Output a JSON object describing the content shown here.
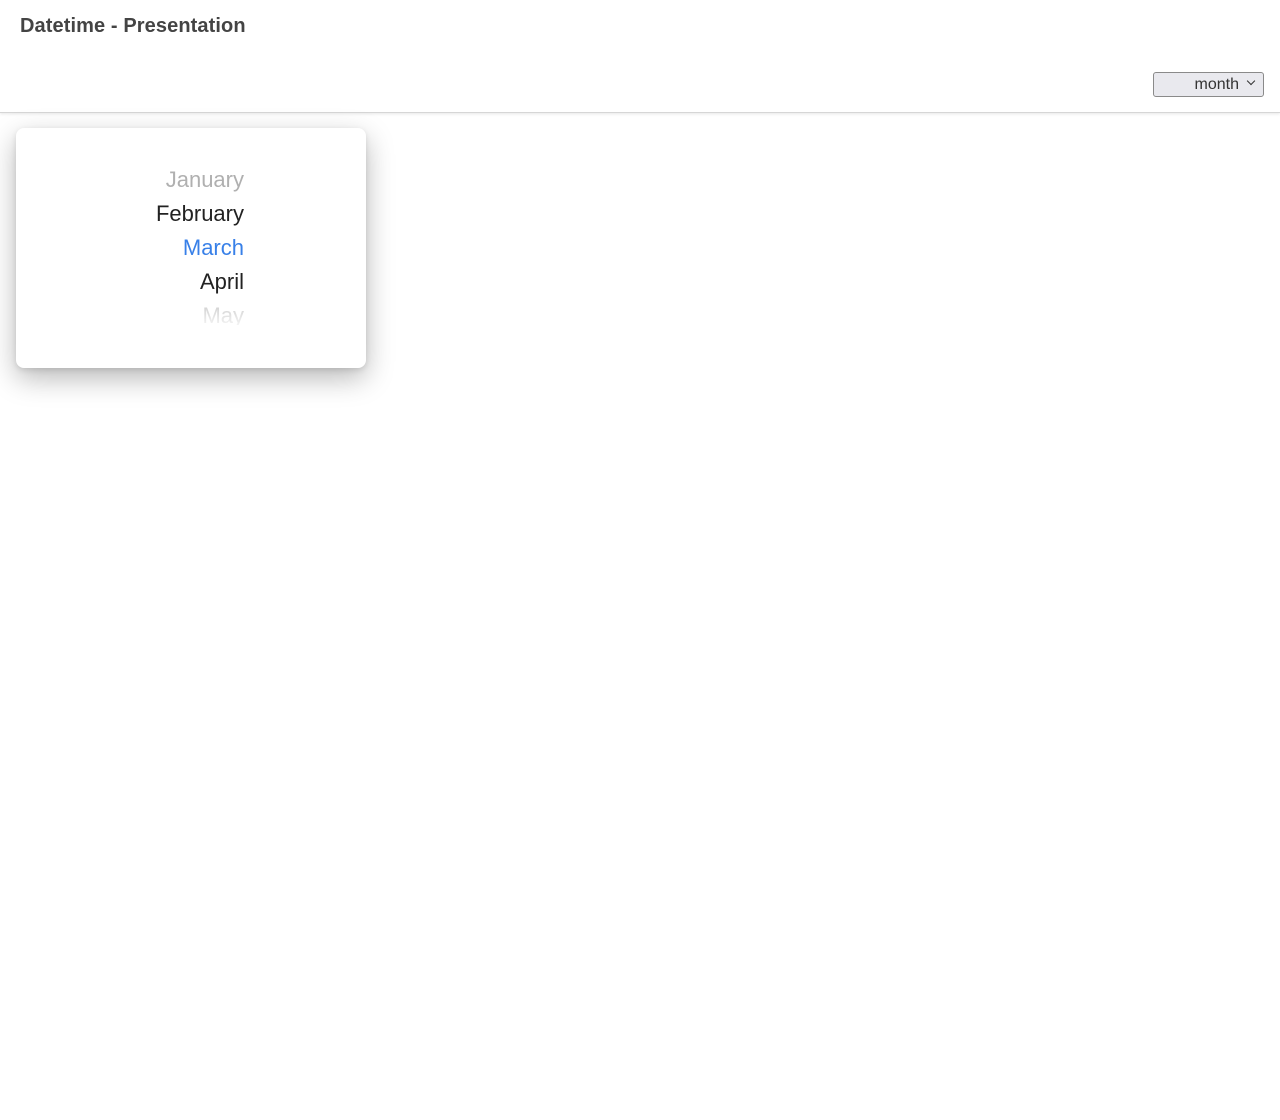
{
  "header": {
    "title": "Datetime - Presentation",
    "presentation_select": {
      "selected": "month"
    }
  },
  "picker": {
    "months": [
      {
        "label": "January",
        "state": "far"
      },
      {
        "label": "February",
        "state": "near"
      },
      {
        "label": "March",
        "state": "selected"
      },
      {
        "label": "April",
        "state": "near"
      },
      {
        "label": "May",
        "state": "edge"
      }
    ],
    "selected_month": "March"
  },
  "colors": {
    "accent": "#3880e8",
    "title_text": "#444444",
    "select_bg": "#e9e9ee"
  },
  "icons": {
    "select_arrow": "chevron-down-icon"
  }
}
